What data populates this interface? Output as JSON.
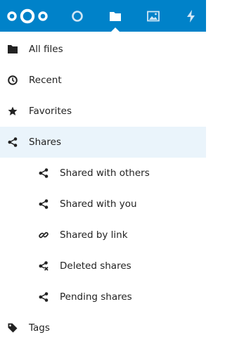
{
  "header": {
    "logo_icon": "nextcloud-logo-icon",
    "apps": [
      {
        "icon": "dashboard-circle-icon",
        "active": false
      },
      {
        "icon": "folder-icon",
        "active": true
      },
      {
        "icon": "image-icon",
        "active": false
      },
      {
        "icon": "lightning-icon",
        "active": false
      }
    ],
    "background_color": "#0082c9"
  },
  "nav": {
    "items": [
      {
        "label": "All files",
        "icon": "folder-icon"
      },
      {
        "label": "Recent",
        "icon": "clock-icon"
      },
      {
        "label": "Favorites",
        "icon": "star-icon"
      },
      {
        "label": "Shares",
        "icon": "share-icon",
        "active": true
      },
      {
        "label": "Shared with others",
        "icon": "share-icon"
      },
      {
        "label": "Shared with you",
        "icon": "share-icon"
      },
      {
        "label": "Shared by link",
        "icon": "link-icon"
      },
      {
        "label": "Deleted shares",
        "icon": "deleted-share-icon"
      },
      {
        "label": "Pending shares",
        "icon": "share-icon"
      },
      {
        "label": "Tags",
        "icon": "tag-icon"
      }
    ],
    "active_background": "#eaf4fb"
  }
}
